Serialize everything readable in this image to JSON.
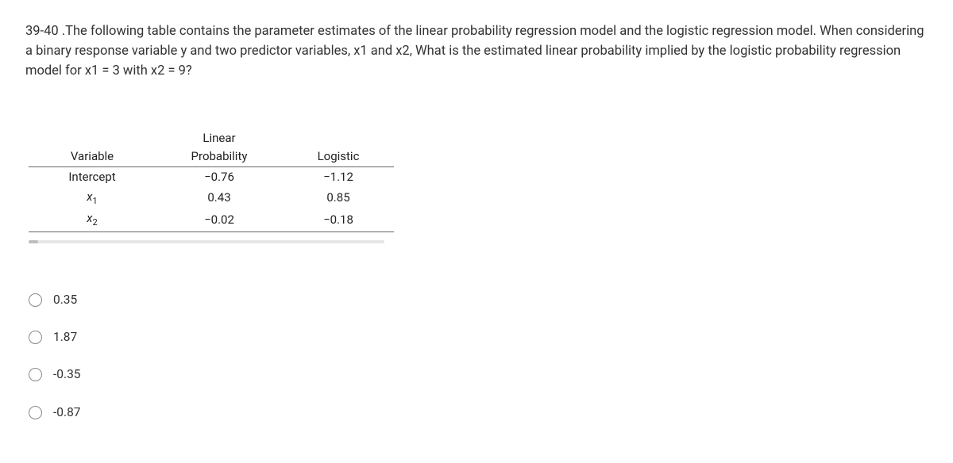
{
  "question": {
    "text": "39-40 .The following table contains the parameter estimates of the linear probability regression model and the logistic regression model. When considering a binary response variable y and two predictor variables, x1 and x2, What is the estimated linear probability implied by the logistic probability regression model for x1 = 3 with x2 = 9?"
  },
  "table": {
    "headers": {
      "variable": "Variable",
      "linear_line1": "Linear",
      "linear_line2": "Probability",
      "logistic": "Logistic"
    },
    "rows": [
      {
        "variable": "Intercept",
        "linear": "−0.76",
        "logistic": "−1.12"
      },
      {
        "variable_html": "x1",
        "linear": "0.43",
        "logistic": "0.85"
      },
      {
        "variable_html": "x2",
        "linear": "−0.02",
        "logistic": "−0.18"
      }
    ]
  },
  "options": [
    {
      "label": "0.35"
    },
    {
      "label": "1.87"
    },
    {
      "label": "-0.35"
    },
    {
      "label": "-0.87"
    }
  ],
  "chart_data": {
    "type": "table",
    "title": "Parameter estimates",
    "columns": [
      "Variable",
      "Linear Probability",
      "Logistic"
    ],
    "rows": [
      [
        "Intercept",
        -0.76,
        -1.12
      ],
      [
        "x1",
        0.43,
        0.85
      ],
      [
        "x2",
        -0.02,
        -0.18
      ]
    ]
  }
}
